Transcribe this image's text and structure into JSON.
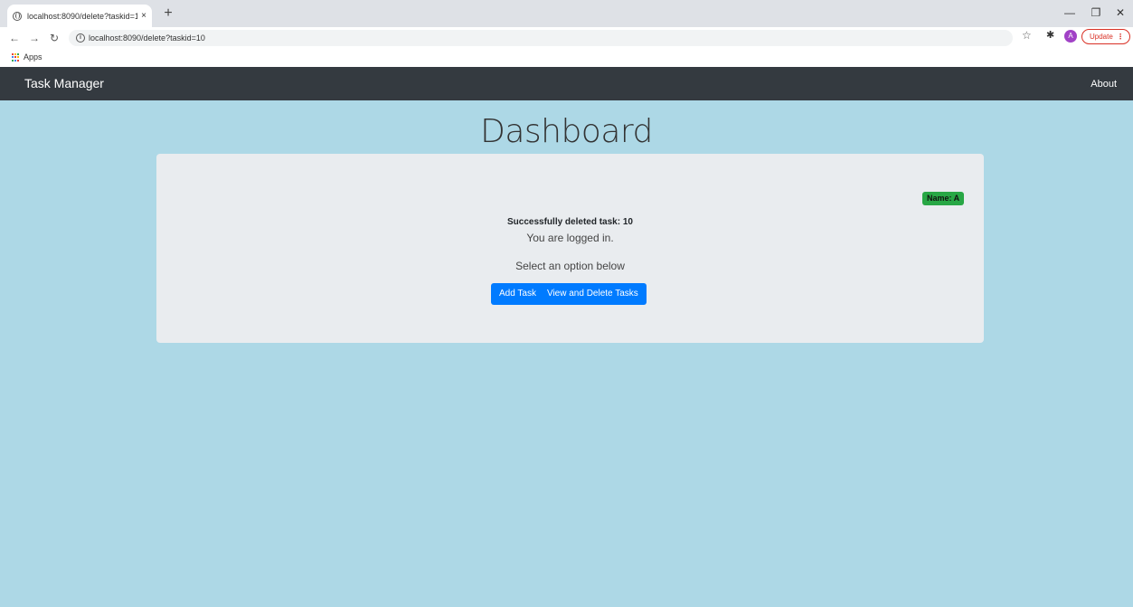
{
  "browser": {
    "tab_title": "localhost:8090/delete?taskid=10",
    "tab_close": "×",
    "new_tab": "+",
    "url": "localhost:8090/delete?taskid=10",
    "avatar_letter": "A",
    "update_label": "Update",
    "update_menu": "⋮",
    "bookmarks": {
      "apps_label": "Apps"
    },
    "icons": [
      "globe-icon",
      "back-arrow-icon",
      "forward-arrow-icon",
      "reload-icon",
      "info-icon",
      "star-icon",
      "extensions-icon",
      "apps-icon",
      "minimize-icon",
      "restore-icon",
      "close-icon"
    ]
  },
  "navbar": {
    "brand": "Task Manager",
    "about": "About"
  },
  "page": {
    "heading": "Dashboard",
    "name_badge": "Name: A",
    "success_message": "Successfully deleted task: 10",
    "logged_in": "You are logged in.",
    "select_prompt": "Select an option below",
    "buttons": {
      "add_task": "Add Task",
      "view_delete": "View and Delete Tasks"
    }
  },
  "colors": {
    "navbar": "#343a40",
    "background": "#add8e6",
    "card": "#e9ecef",
    "badge": "#28a745",
    "button": "#007bff"
  }
}
